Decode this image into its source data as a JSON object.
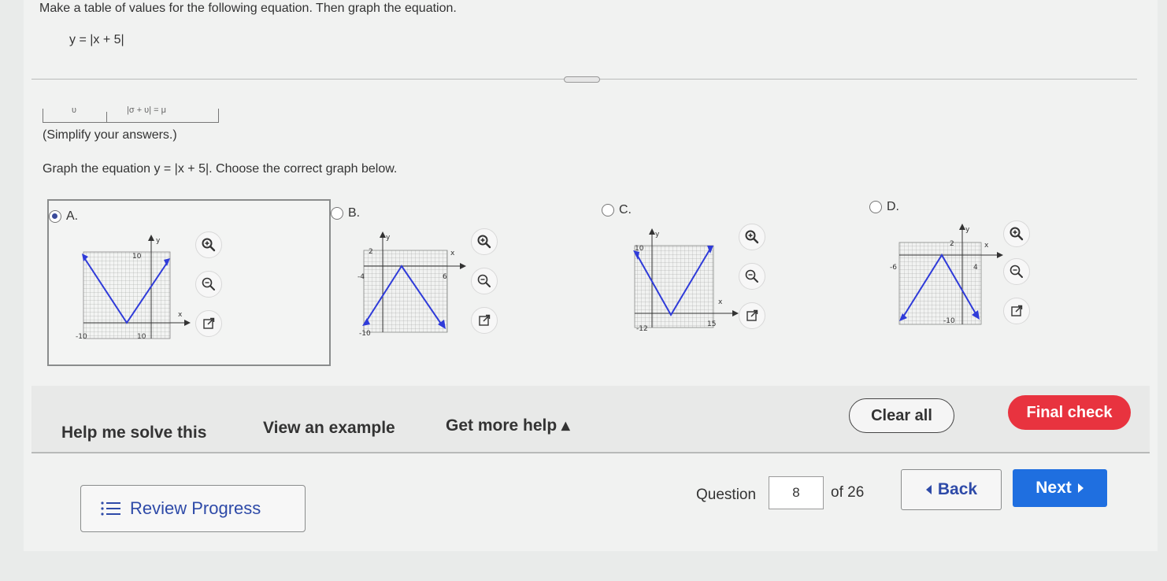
{
  "problem": {
    "instruction": "Make a table of values for the following equation. Then graph the equation.",
    "equation": "y = |x + 5|",
    "table_cells": [
      "υ",
      "|σ + υ| = μ"
    ],
    "simplify_note": "(Simplify your answers.)",
    "graph_prompt": "Graph the equation y = |x + 5|. Choose the correct graph below."
  },
  "options": [
    {
      "letter": "A.",
      "selected": true,
      "ticks": [
        "10",
        "-10",
        "10"
      ]
    },
    {
      "letter": "B.",
      "selected": false,
      "ticks": [
        "2",
        "-4",
        "6",
        "-10"
      ]
    },
    {
      "letter": "C.",
      "selected": false,
      "ticks": [
        "10",
        "-12",
        "15"
      ]
    },
    {
      "letter": "D.",
      "selected": false,
      "ticks": [
        "2",
        "-6",
        "4",
        "-10"
      ]
    }
  ],
  "graph_axis_labels": {
    "x": "x",
    "y": "y"
  },
  "help": {
    "solve": "Help me solve this",
    "example": "View an example",
    "more": "Get more help ▴"
  },
  "actions": {
    "clear": "Clear all",
    "final": "Final check"
  },
  "footer": {
    "review": "Review Progress",
    "question_label": "Question",
    "question_number": "8",
    "question_total": "of 26",
    "back": "Back",
    "next": "Next"
  },
  "colors": {
    "line": "#2f3bd9",
    "final_button": "#e8333f",
    "next_button": "#1f6fe0",
    "link": "#2e4aa8"
  },
  "icons": [
    "zoom-in-icon",
    "zoom-out-icon",
    "open-in-new-icon",
    "list-icon",
    "back-arrow-icon",
    "next-arrow-icon"
  ]
}
